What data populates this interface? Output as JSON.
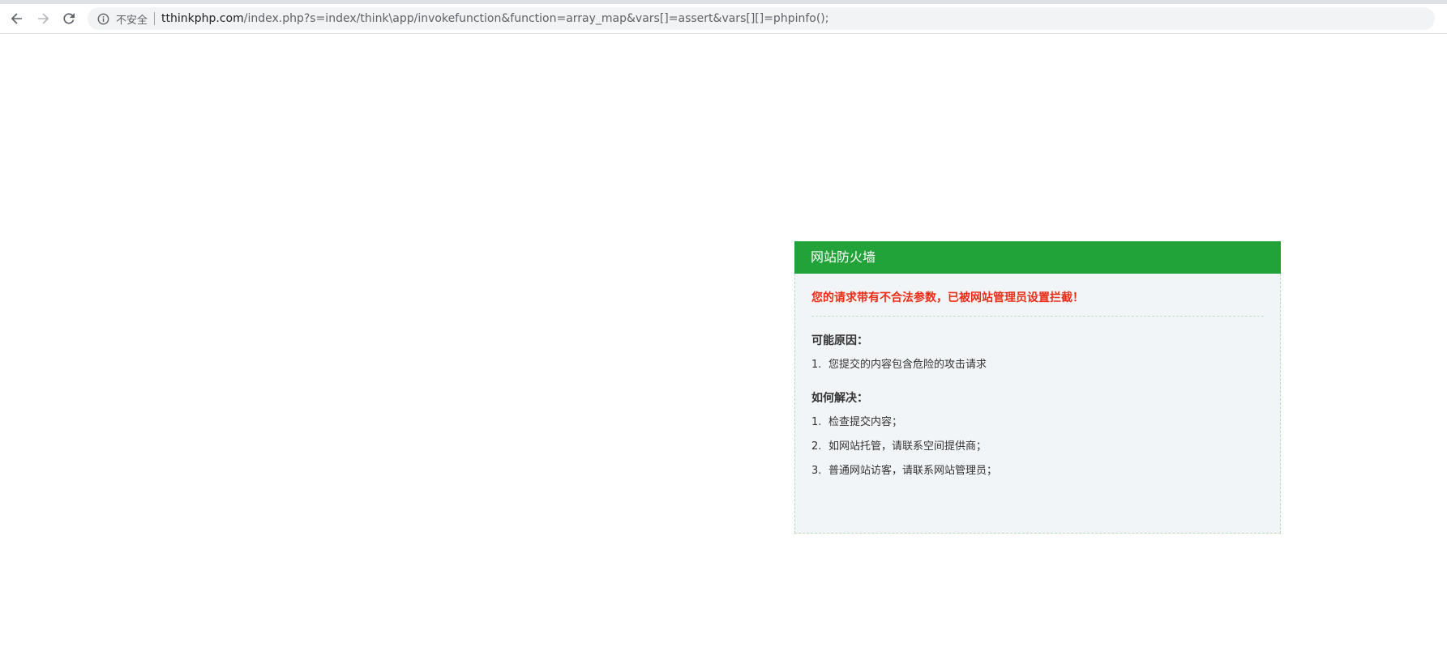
{
  "browser": {
    "back_icon": "arrow-left-icon",
    "forward_icon": "arrow-right-icon",
    "reload_icon": "reload-icon",
    "info_icon": "info-icon",
    "security_label": "不安全",
    "url_host": "tthinkphp.com",
    "url_rest": "/index.php?s=index/think\\app/invokefunction&function=array_map&vars[]=assert&vars[][]=phpinfo();"
  },
  "firewall": {
    "title": "网站防火墙",
    "warning": "您的请求带有不合法参数，已被网站管理员设置拦截！",
    "reason_title": "可能原因：",
    "reasons": [
      {
        "num": "1.",
        "text": "您提交的内容包含危险的攻击请求"
      }
    ],
    "solution_title": "如何解决：",
    "solutions": [
      {
        "num": "1.",
        "text": "检查提交内容；"
      },
      {
        "num": "2.",
        "text": "如网站托管，请联系空间提供商；"
      },
      {
        "num": "3.",
        "text": "普通网站访客，请联系网站管理员；"
      }
    ],
    "colors": {
      "header": "#21a33a",
      "warning": "#ec2d16",
      "body_bg": "#f2f5f7"
    }
  }
}
